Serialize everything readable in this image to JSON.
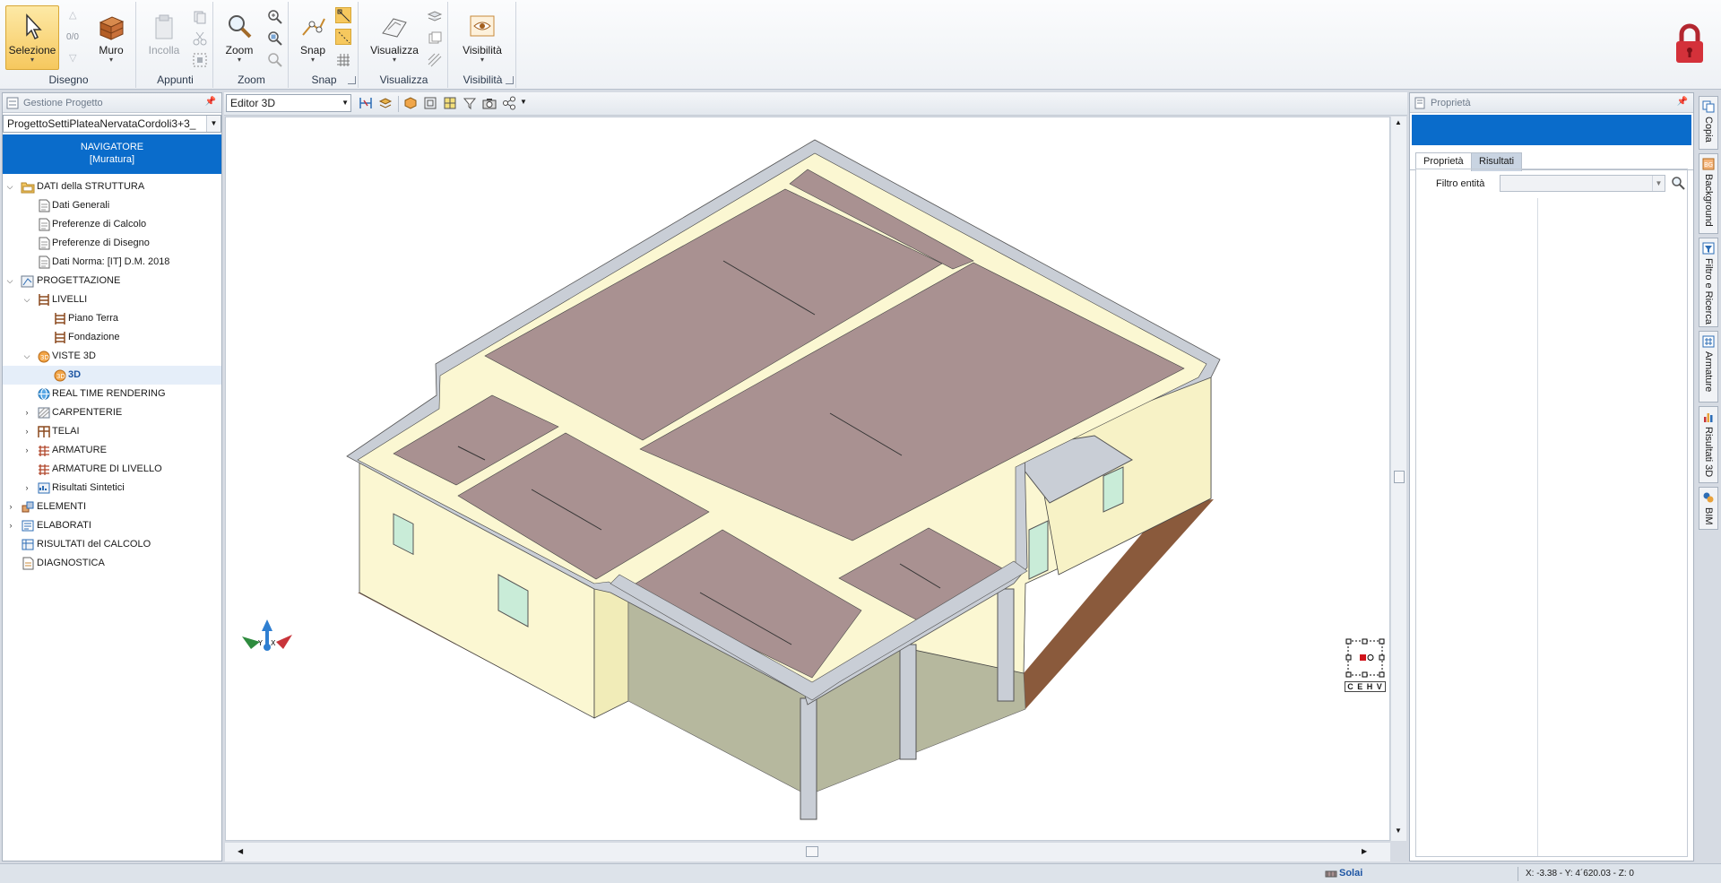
{
  "ribbon": {
    "groups": {
      "disegno": "Disegno",
      "appunti": "Appunti",
      "zoom": "Zoom",
      "snap": "Snap",
      "visualizza": "Visualizza",
      "visibilita": "Visibilità"
    },
    "buttons": {
      "selezione": "Selezione",
      "undo_count": "0/0",
      "muro": "Muro",
      "incolla": "Incolla",
      "zoom": "Zoom",
      "snap": "Snap",
      "visualizza": "Visualizza",
      "visibilita": "Visibilità"
    }
  },
  "left_panel": {
    "title": "Gestione Progetto",
    "project_select": "ProgettoSettiPlateaNervataCordoli3+3_",
    "navigator_title": "NAVIGATORE",
    "navigator_subtitle": "[Muratura]",
    "tree": {
      "dati_struttura": "DATI della STRUTTURA",
      "dati_generali": "Dati Generali",
      "pref_calcolo": "Preferenze di Calcolo",
      "pref_disegno": "Preferenze di Disegno",
      "dati_norma": "Dati Norma: [IT] D.M. 2018",
      "progettazione": "PROGETTAZIONE",
      "livelli": "LIVELLI",
      "piano_terra": "Piano Terra",
      "fondazione": "Fondazione",
      "viste3d": "VISTE 3D",
      "v3d": "3D",
      "rendering": "REAL TIME RENDERING",
      "carpenterie": "CARPENTERIE",
      "telai": "TELAI",
      "armature": "ARMATURE",
      "armature_livello": "ARMATURE DI LIVELLO",
      "risultati_sintetici": "Risultati Sintetici",
      "elementi": "ELEMENTI",
      "elaborati": "ELABORATI",
      "risultati_calcolo": "RISULTATI del CALCOLO",
      "diagnostica": "DIAGNOSTICA"
    }
  },
  "editor": {
    "view_select": "Editor 3D",
    "cube_letters": "C E H V",
    "axis_labels": {
      "x": "X",
      "y": "Y"
    }
  },
  "right_panel": {
    "title": "Proprietà",
    "tab_props": "Proprietà",
    "tab_results": "Risultati",
    "filter_label": "Filtro entità"
  },
  "side_tabs": {
    "copia": "Copia",
    "background": "Background",
    "filtro": "Filtro e Ricerca",
    "armature": "Armature",
    "risultati3d": "Risultati 3D",
    "bim": "BIM"
  },
  "status": {
    "mode": "Solai",
    "coords": "X: -3.38 - Y: 4´620.03 - Z: 0"
  },
  "colors": {
    "accent_blue": "#0a6ccb",
    "slab": "#a99191",
    "wall": "#fbf7d2",
    "beam": "#c9ced6",
    "foundation": "#8a5a3c",
    "lock_red": "#d4313a"
  }
}
